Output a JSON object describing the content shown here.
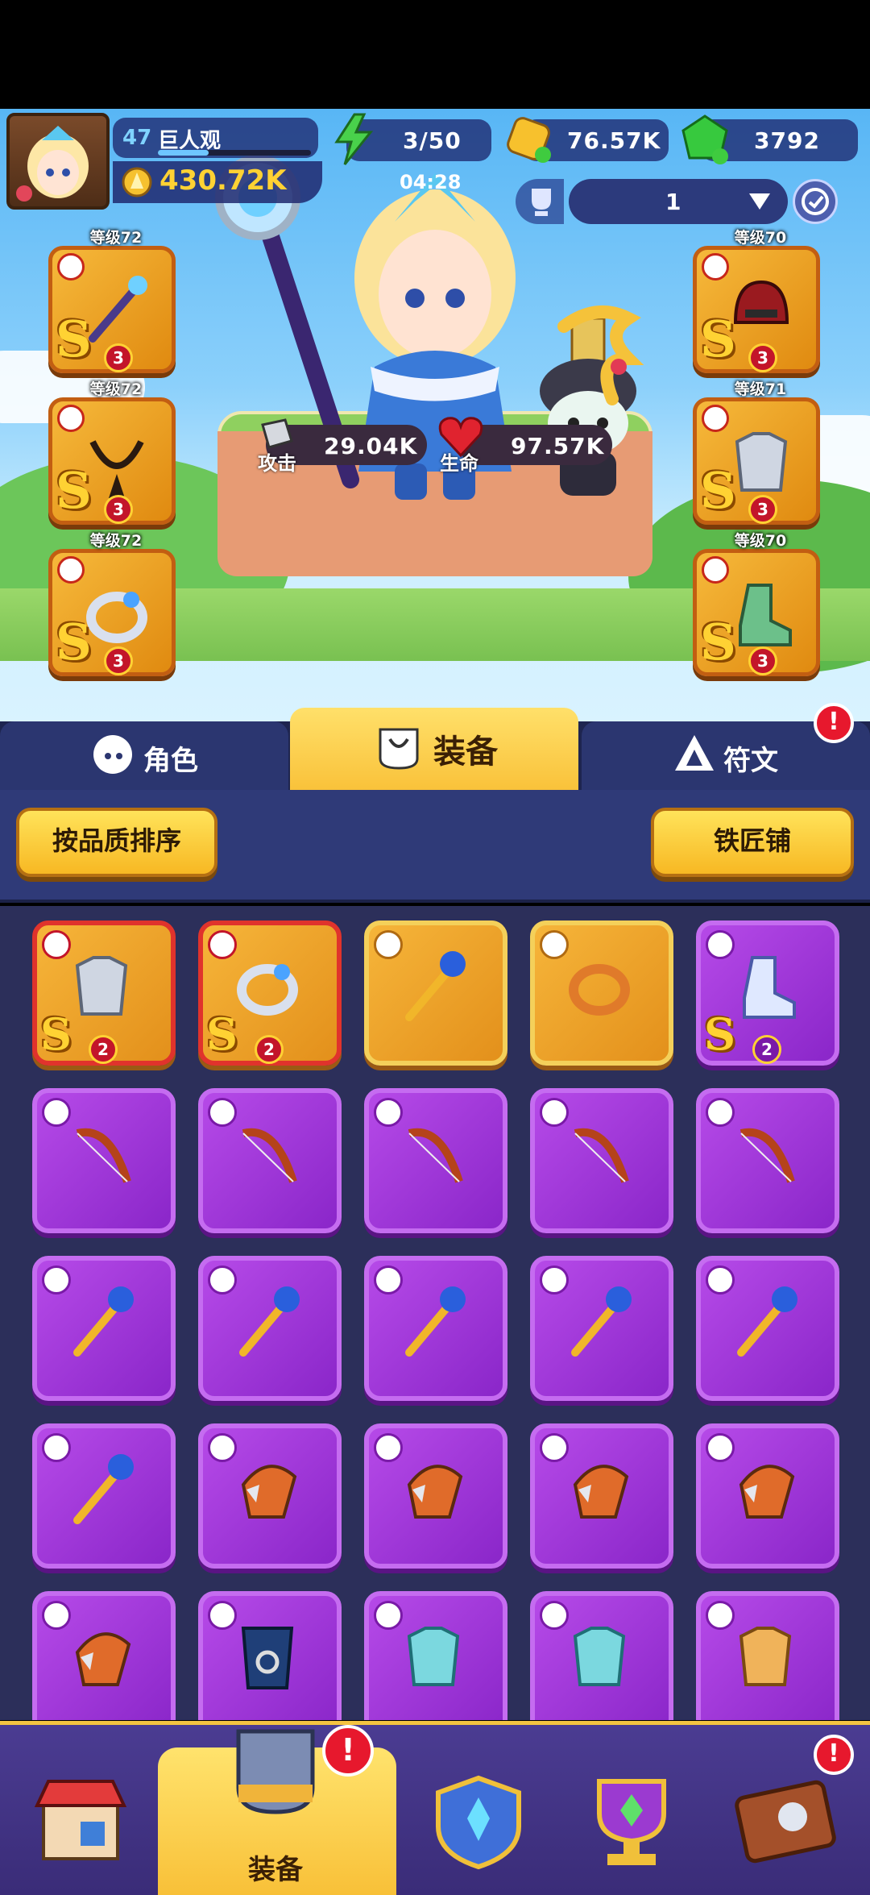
{
  "player": {
    "level": "47",
    "name": "巨人观",
    "power": "430.72K"
  },
  "resources": {
    "energy": "3/50",
    "timer": "04:28",
    "coins": "76.57K",
    "gems": "3792"
  },
  "selector": {
    "value": "1"
  },
  "equipped_left": [
    {
      "level": "等级72",
      "stars": "3",
      "badge": "S"
    },
    {
      "level": "等级72",
      "stars": "3",
      "badge": "S"
    },
    {
      "level": "等级72",
      "stars": "3",
      "badge": "S"
    }
  ],
  "equipped_right": [
    {
      "level": "等级70",
      "stars": "3",
      "badge": "S"
    },
    {
      "level": "等级71",
      "stars": "3",
      "badge": "S"
    },
    {
      "level": "等级70",
      "stars": "3",
      "badge": "S"
    }
  ],
  "stats": {
    "attack_label": "攻击",
    "attack": "29.04K",
    "hp_label": "生命",
    "hp": "97.57K"
  },
  "tabs": {
    "role": "角色",
    "equipment": "装备",
    "rune": "符文",
    "rune_alert": "!"
  },
  "sort": {
    "quality": "按品质排序",
    "blacksmith": "铁匠铺"
  },
  "inventory_badges": {
    "s": "S",
    "stars_top": "2"
  },
  "bottom_nav": {
    "equipment_label": "装备",
    "alert": "!"
  },
  "colors": {
    "gold": "#f6b53a",
    "purple": "#a63de0",
    "navy": "#2a2f5e",
    "accent": "#ffd233"
  }
}
